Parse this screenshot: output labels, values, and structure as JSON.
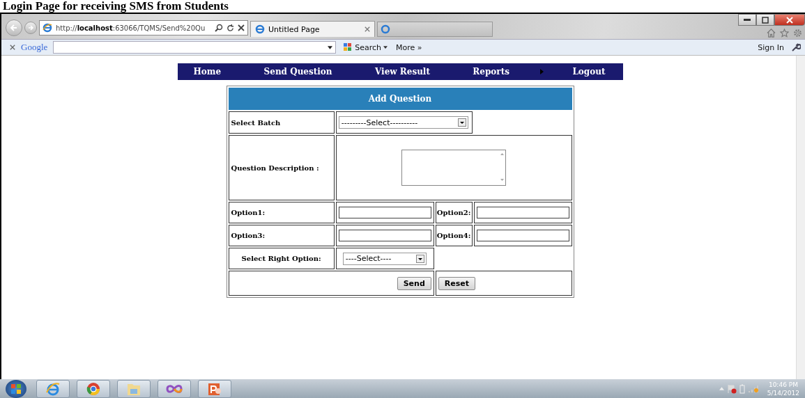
{
  "caption": "Login Page for receiving SMS from Students",
  "browser": {
    "address": "http://**localhost**:63066/TQMS/Send%20Qu",
    "tabs": [
      {
        "title": "Untitled Page",
        "selected": true
      }
    ],
    "toolbar": {
      "brand": "Google",
      "search": "Search",
      "more": "More »",
      "sign_in": "Sign In"
    }
  },
  "nav": [
    {
      "label": "Home",
      "submenu": false
    },
    {
      "label": "Send Question",
      "submenu": false
    },
    {
      "label": "View Result",
      "submenu": false
    },
    {
      "label": "Reports",
      "submenu": true
    },
    {
      "label": "Logout",
      "submenu": false
    }
  ],
  "form": {
    "title": "Add Question",
    "batch_label": "Select Batch",
    "batch_select": "---------Select----------",
    "description_label": "Question Description :",
    "options": [
      {
        "label": "Option1:"
      },
      {
        "label": "Option2:"
      },
      {
        "label": "Option3:"
      },
      {
        "label": "Option4:"
      }
    ],
    "right_label": "Select Right Option:",
    "right_select": "----Select----",
    "send": "Send",
    "reset": "Reset"
  },
  "taskbar": {
    "time": "10:46 PM",
    "date": "5/14/2012"
  }
}
